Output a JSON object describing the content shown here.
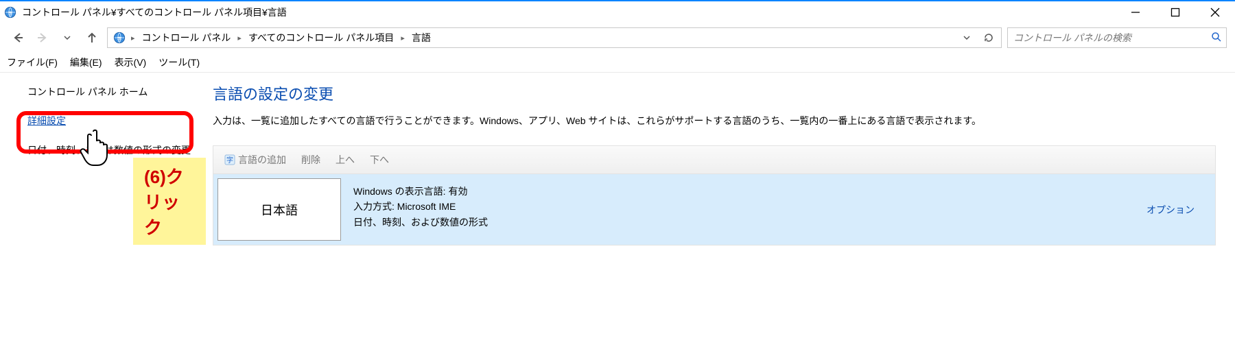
{
  "window": {
    "title": "コントロール パネル¥すべてのコントロール パネル項目¥言語"
  },
  "breadcrumbs": {
    "root": "コントロール パネル",
    "mid": "すべてのコントロール パネル項目",
    "leaf": "言語"
  },
  "search": {
    "placeholder": "コントロール パネルの検索"
  },
  "menu": {
    "file": "ファイル(F)",
    "edit": "編集(E)",
    "view": "表示(V)",
    "tools": "ツール(T)"
  },
  "sidebar": {
    "home": "コントロール パネル ホーム",
    "advanced": "詳細設定",
    "datefmt": "日付、時刻、または数値の形式の変更"
  },
  "annotation": {
    "label": "(6)クリック"
  },
  "main": {
    "heading": "言語の設定の変更",
    "description": "入力は、一覧に追加したすべての言語で行うことができます。Windows、アプリ、Web サイトは、これらがサポートする言語のうち、一覧内の一番上にある言語で表示されます。"
  },
  "toolbar": {
    "add": "言語の追加",
    "remove": "削除",
    "up": "上へ",
    "down": "下へ"
  },
  "language_row": {
    "name": "日本語",
    "line1": "Windows の表示言語: 有効",
    "line2": "入力方式: Microsoft IME",
    "line3": "日付、時刻、および数値の形式",
    "options": "オプション"
  }
}
